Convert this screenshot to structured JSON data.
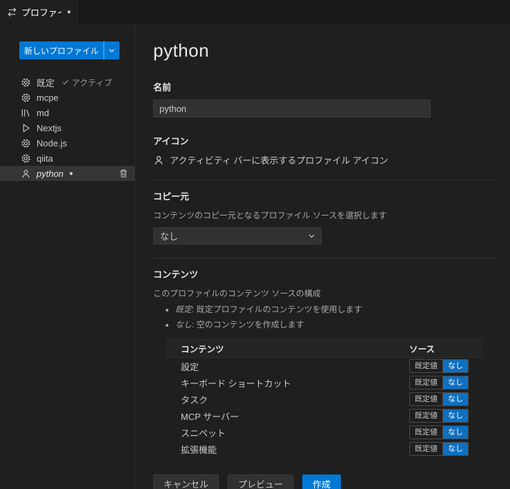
{
  "tab": {
    "title": "プロファイル",
    "dirty_dot": "●"
  },
  "sidebar": {
    "new_profile_button": "新しいプロファイル",
    "profiles": [
      {
        "name": "既定",
        "icon": "gear-icon",
        "badge": "アクティブ",
        "active": true
      },
      {
        "name": "mcpe",
        "icon": "gear-icon"
      },
      {
        "name": "md",
        "icon": "library-icon"
      },
      {
        "name": "Nextjs",
        "icon": "run-icon"
      },
      {
        "name": "Node.js",
        "icon": "gear-icon"
      },
      {
        "name": "qiita",
        "icon": "gear-icon"
      },
      {
        "name": "python",
        "icon": "account-icon",
        "selected": true,
        "dirty_dot": "●"
      }
    ]
  },
  "main": {
    "title": "python",
    "name_label": "名前",
    "name_value": "python",
    "icon_label": "アイコン",
    "icon_hint": "アクティビティ バーに表示するプロファイル アイコン",
    "copy_from": {
      "label": "コピー元",
      "description": "コンテンツのコピー元となるプロファイル ソースを選択します",
      "selected": "なし"
    },
    "contents": {
      "label": "コンテンツ",
      "description": "このプロファイルのコンテンツ ソースの構成",
      "bullets": [
        {
          "term": "既定",
          "text": ": 既定プロファイルのコンテンツを使用します"
        },
        {
          "term": "なし",
          "text": ": 空のコンテンツを作成します"
        }
      ],
      "table": {
        "headers": [
          "コンテンツ",
          "ソース"
        ],
        "rows": [
          {
            "label": "設定",
            "options": [
              "既定値",
              "なし"
            ],
            "selected": "なし"
          },
          {
            "label": "キーボード ショートカット",
            "options": [
              "既定値",
              "なし"
            ],
            "selected": "なし"
          },
          {
            "label": "タスク",
            "options": [
              "既定値",
              "なし"
            ],
            "selected": "なし"
          },
          {
            "label": "MCP サーバー",
            "options": [
              "既定値",
              "なし"
            ],
            "selected": "なし"
          },
          {
            "label": "スニペット",
            "options": [
              "既定値",
              "なし"
            ],
            "selected": "なし"
          },
          {
            "label": "拡張機能",
            "options": [
              "既定値",
              "なし"
            ],
            "selected": "なし"
          }
        ]
      }
    },
    "footer": {
      "cancel": "キャンセル",
      "preview": "プレビュー",
      "create": "作成"
    }
  },
  "colors": {
    "accent": "#0078d4",
    "selected_source": "#0e70c0"
  }
}
